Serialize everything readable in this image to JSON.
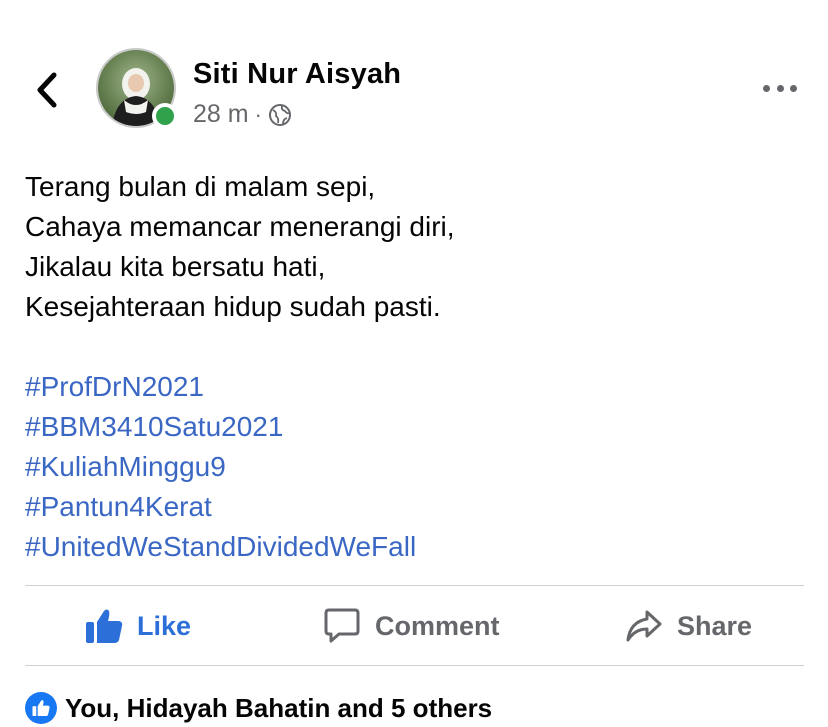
{
  "post": {
    "author": "Siti Nur Aisyah",
    "time": "28 m",
    "separator": "·",
    "privacy_icon": "globe-icon",
    "online": true,
    "body_lines": [
      "Terang bulan di malam sepi,",
      "Cahaya memancar menerangi diri,",
      "Jikalau kita bersatu hati,",
      "Kesejahteraan hidup sudah pasti."
    ],
    "hashtags": [
      "#ProfDrN2021",
      "#BBM3410Satu2021",
      "#KuliahMinggu9",
      "#Pantun4Kerat",
      "#UnitedWeStandDividedWeFall"
    ]
  },
  "actions": {
    "like": "Like",
    "comment": "Comment",
    "share": "Share"
  },
  "reactions": {
    "summary": "You, Hidayah Bahatin and 5 others"
  },
  "colors": {
    "accent": "#1877f2",
    "hashtag": "#3b67c4",
    "secondary_text": "#65676b",
    "online": "#31a24c",
    "divider": "#ced0d4"
  },
  "icons": {
    "back": "chevron-left-icon",
    "more": "more-dots-icon",
    "like": "thumbs-up-icon",
    "comment": "comment-bubble-icon",
    "share": "share-arrow-icon"
  }
}
